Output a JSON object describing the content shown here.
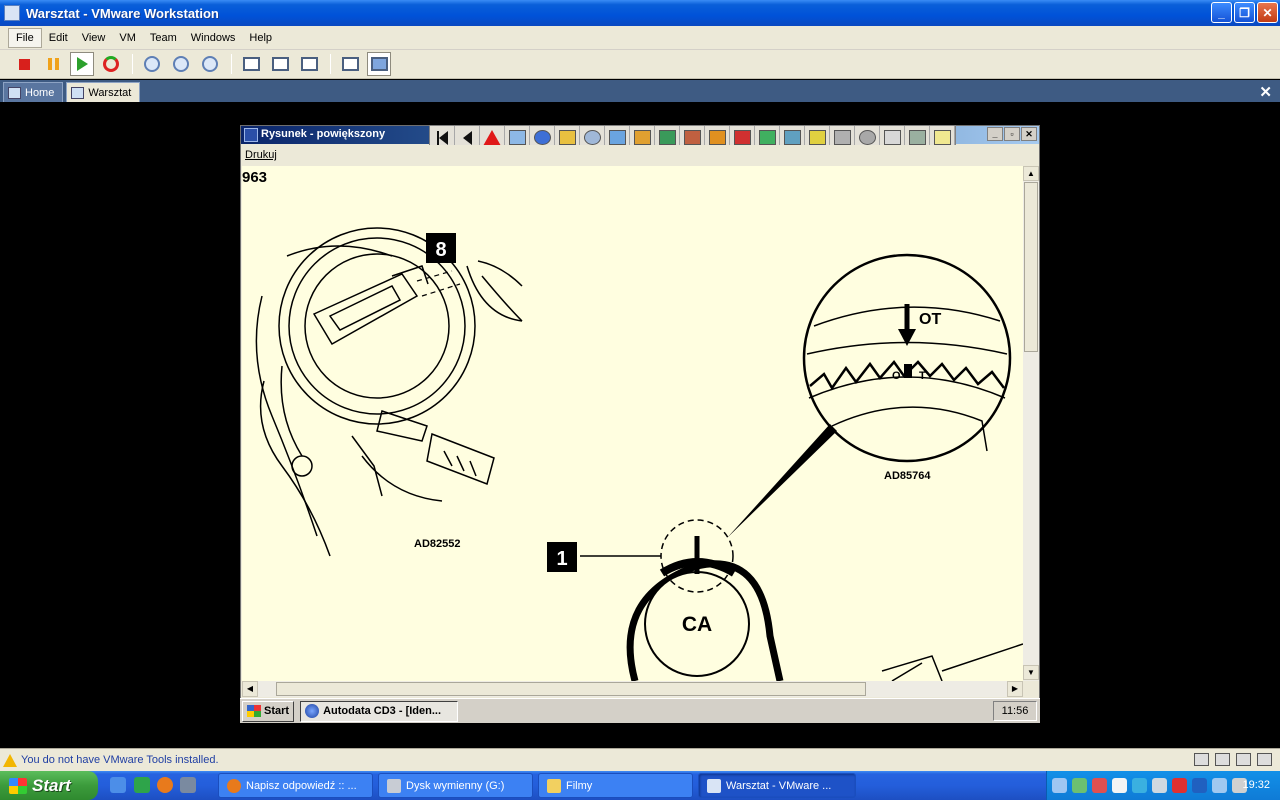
{
  "window": {
    "title": "Warsztat - VMware Workstation",
    "min_glyph": "_",
    "restore_glyph": "❐",
    "close_glyph": "✕"
  },
  "menu": {
    "items": [
      "File",
      "Edit",
      "View",
      "VM",
      "Team",
      "Windows",
      "Help"
    ]
  },
  "tabs": {
    "home": "Home",
    "active": "Warsztat",
    "close_glyph": "✕"
  },
  "inner_window": {
    "title": "Rysunek - powiększony",
    "menu_print": "Drukuj",
    "ctrl_min": "_",
    "ctrl_max": "▫",
    "ctrl_close": "✕"
  },
  "drawing": {
    "corner_label": "963",
    "callout_8": "8",
    "callout_1": "1",
    "ref_left": "AD82552",
    "ref_right": "AD85764",
    "mark_ot": "OT",
    "mark_o": "O",
    "mark_t": "T",
    "pulley_label": "CA",
    "bg_color": "#fffee0"
  },
  "guest_taskbar": {
    "start": "Start",
    "task": "Autodata CD3 - [Iden...",
    "clock": "11:56"
  },
  "status": {
    "message": "You do not have VMware Tools installed."
  },
  "taskbar": {
    "start": "Start",
    "tasks": [
      {
        "label": "Napisz odpowiedź :: ...",
        "icon": "firefox-icon"
      },
      {
        "label": "Dysk wymienny (G:)",
        "icon": "drive-icon"
      },
      {
        "label": "Filmy",
        "icon": "folder-icon"
      },
      {
        "label": "Warsztat - VMware ...",
        "icon": "vmware-icon"
      }
    ],
    "clock": "19:32"
  }
}
